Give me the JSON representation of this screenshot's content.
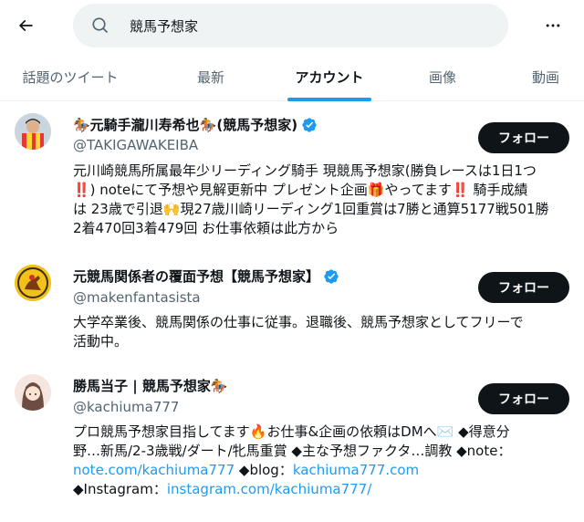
{
  "search": {
    "query": "競馬予想家"
  },
  "tabs": [
    "話題のツイート",
    "最新",
    "アカウント",
    "画像",
    "動画"
  ],
  "active_tab": "アカウント",
  "users": [
    {
      "name": "🏇元騎手瀧川寿希也🏇(競馬予想家)",
      "handle": "@TAKIGAWAKEIBA",
      "follow_label": "フォロー",
      "bio_lines": [
        "元川崎競馬所属最年少リーディング騎手 現競馬予想家(勝負レースは1日1つ",
        "‼️) noteにて予想や見解更新中 プレゼント企画🎁やってます‼️ 騎手成績",
        "は 23歳で引退🙌現27歳川崎リーディング1回重賞は7勝と通算5177戦501勝",
        "2着470回3着479回 お仕事依頼は此方から"
      ]
    },
    {
      "name": "元競馬関係者の覆面予想【競馬予想家】",
      "handle": "@makenfantasista",
      "follow_label": "フォロー",
      "bio_lines": [
        "大学卒業後、競馬関係の仕事に従事。退職後、競馬予想家としてフリーで",
        "活動中。"
      ]
    },
    {
      "name": "勝馬当子 | 競馬予想家🏇",
      "handle": "@kachiuma777",
      "follow_label": "フォロー",
      "bio_line1": "プロ競馬予想家目指してます🔥お仕事&企画の依頼はDMへ✉️ ◆得意分",
      "bio_line2": "野…新馬/2-3歳戦/ダート/牝馬重賞 ◆主な予想ファクタ…調教 ◆note：",
      "bio_link1": "note.com/kachiuma777",
      "bio_line3_mid": " ◆blog：",
      "bio_link2": "kachiuma777.com",
      "bio_line4_pre": "◆Instagram：",
      "bio_link3": "instagram.com/kachiuma777/"
    }
  ],
  "colors": {
    "accent": "#1d9bf0",
    "text": "#0f1419",
    "muted": "#536471",
    "button": "#0f1419"
  }
}
